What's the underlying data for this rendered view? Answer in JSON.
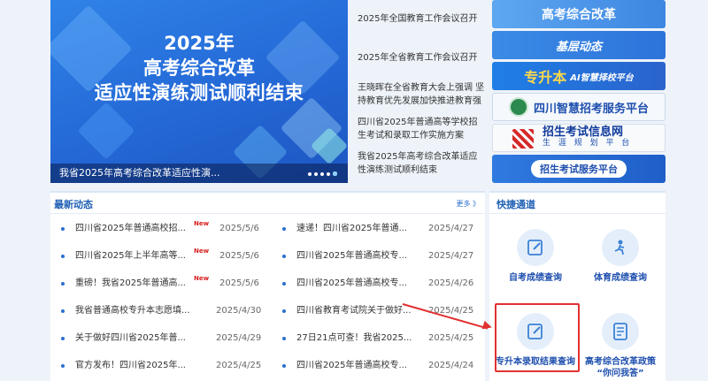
{
  "banner": {
    "title_line1": "2025年",
    "title_line2": "高考综合改革",
    "title_line3": "适应性演练测试顺利结束",
    "caption": "我省2025年高考综合改革适应性演..."
  },
  "top_news": [
    "2025年全国教育工作会议召开",
    "2025年全省教育工作会议召开",
    "王晓晖在全省教育大会上强调 坚持教育优先发展加快推进教育强省...",
    "四川省2025年普通高等学校招生考试和录取工作实施方案",
    "我省2025年高考综合改革适应性演练测试顺利结束"
  ],
  "link_banners": {
    "reform": "高考综合改革",
    "grassroots": "基层动态",
    "upgrade_main": "专升本",
    "upgrade_sub": "AI智慧择校平台",
    "smart_platform": "四川智慧招考服务平台",
    "info_main": "招生考试信息网",
    "info_sub": "生 涯 规 划 平 台",
    "service_platform": "招生考试服务平台"
  },
  "news_panel": {
    "title": "最新动态",
    "more": "更多 》",
    "new_badge": "New",
    "left_items": [
      {
        "title": "四川省2025年普通高校招...",
        "date": "2025/5/6",
        "new": true
      },
      {
        "title": "四川省2025年上半年高等...",
        "date": "2025/5/6",
        "new": true
      },
      {
        "title": "重磅！我省2025年普通高...",
        "date": "2025/5/6",
        "new": true
      },
      {
        "title": "我省普通高校专升本志愿填...",
        "date": "2025/4/30",
        "new": false
      },
      {
        "title": "关于做好四川省2025年普...",
        "date": "2025/4/29",
        "new": false
      },
      {
        "title": "官方发布！四川省2025年...",
        "date": "2025/4/25",
        "new": false
      }
    ],
    "right_items": [
      {
        "title": "速递！四川省2025年普通...",
        "date": "2025/4/27"
      },
      {
        "title": "四川省2025年普通高校专...",
        "date": "2025/4/27"
      },
      {
        "title": "四川省2025年普通高校专...",
        "date": "2025/4/26"
      },
      {
        "title": "四川省教育考试院关于做好...",
        "date": "2025/4/25"
      },
      {
        "title": "27日21点可查！我省2025...",
        "date": "2025/4/25"
      },
      {
        "title": "四川省2025年普通高校专...",
        "date": "2025/4/24"
      }
    ]
  },
  "quick_panel": {
    "title": "快捷通道",
    "items": [
      {
        "label": "自考成绩查询"
      },
      {
        "label": "体育成绩查询"
      },
      {
        "label": "专升本录取结果查询"
      },
      {
        "label_line1": "高考综合改革政策",
        "label_line2": "“你问我答”"
      }
    ]
  },
  "colors": {
    "accent": "#1e5fb4",
    "highlight": "#e23232",
    "new_badge": "#d62020"
  }
}
